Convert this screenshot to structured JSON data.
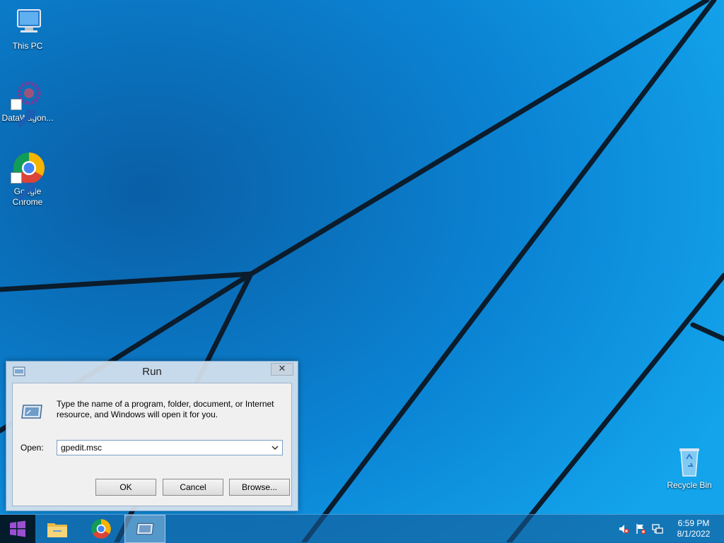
{
  "desktop": {
    "icons": [
      {
        "label": "This PC",
        "icon": "this-pc-icon"
      },
      {
        "label": "DataWagon...",
        "icon": "datawagon-icon"
      },
      {
        "label": "Google Chrome",
        "line1": "Google",
        "line2": "Chrome",
        "icon": "chrome-icon"
      },
      {
        "label": "Recycle Bin",
        "icon": "recycle-bin-icon"
      }
    ]
  },
  "run_dialog": {
    "title": "Run",
    "close_glyph": "✕",
    "description": "Type the name of a program, folder, document, or Internet resource, and Windows will open it for you.",
    "open_label": "Open:",
    "open_value": "gpedit.msc",
    "ok_label": "OK",
    "cancel_label": "Cancel",
    "browse_label": "Browse..."
  },
  "taskbar": {
    "apps": [
      "file-explorer-icon",
      "chrome-icon",
      "run-icon"
    ],
    "tray": [
      "volume-muted-icon",
      "action-center-flag-icon",
      "network-icon"
    ],
    "clock": {
      "time": "6:59 PM",
      "date": "8/1/2022"
    }
  },
  "colors": {
    "wallpaper": "#0a89d8",
    "dialog_frame": "#d6e2ee",
    "taskbar": "#145a96"
  }
}
